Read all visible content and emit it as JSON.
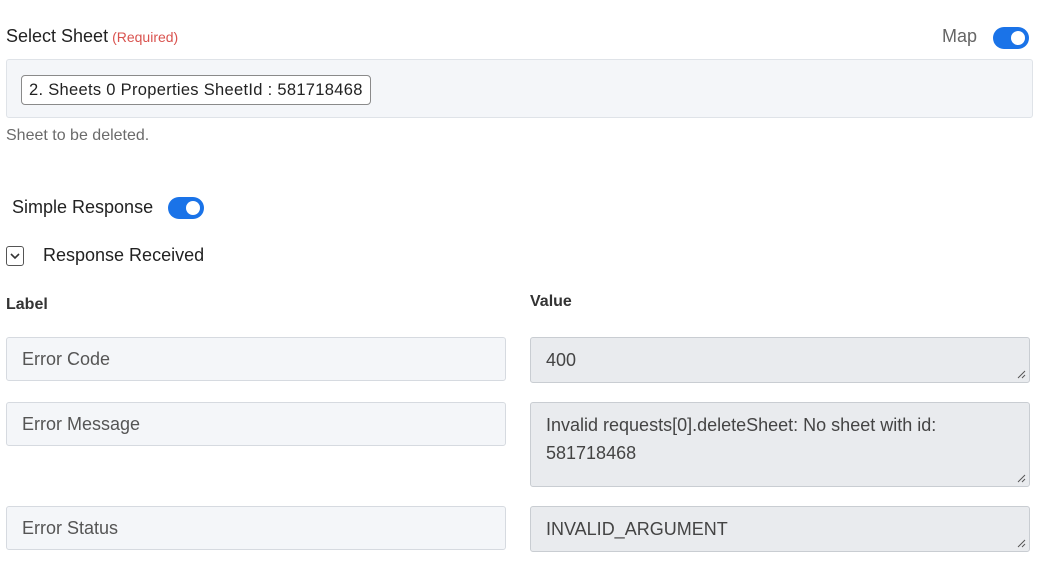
{
  "select_sheet": {
    "label": "Select Sheet",
    "required": "(Required)",
    "map_label": "Map",
    "value": "2. Sheets 0 Properties SheetId : 581718468",
    "help": "Sheet to be deleted."
  },
  "simple_response": {
    "label": "Simple Response"
  },
  "response_received": {
    "label": "Response Received"
  },
  "table": {
    "label_header": "Label",
    "value_header": "Value",
    "rows": [
      {
        "label": "Error Code",
        "value": "400"
      },
      {
        "label": "Error Message",
        "value": "Invalid requests[0].deleteSheet: No sheet with id: 581718468"
      },
      {
        "label": "Error Status",
        "value": "INVALID_ARGUMENT"
      }
    ]
  },
  "colors": {
    "accent": "#1a73e8",
    "required": "#d9534f"
  }
}
